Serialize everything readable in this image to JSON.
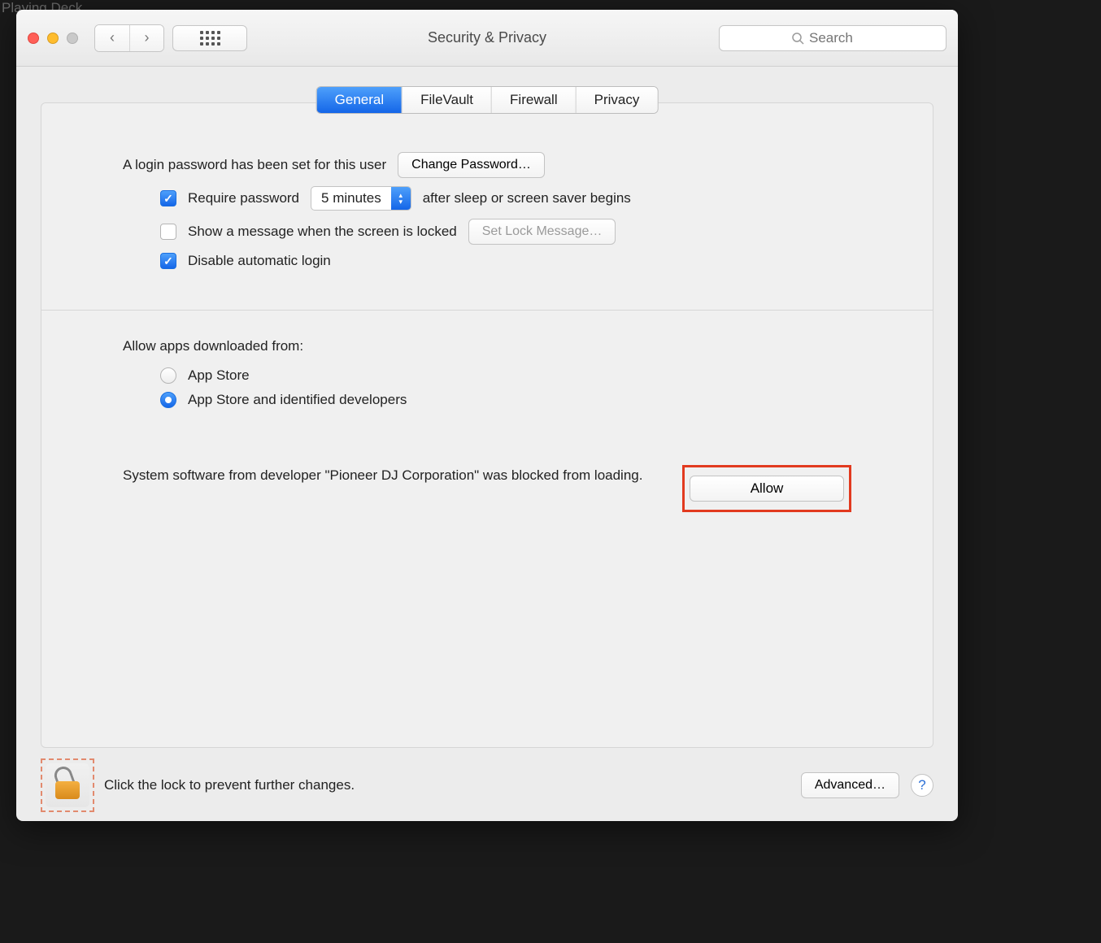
{
  "bg_text": "Playing Deck",
  "window": {
    "title": "Security & Privacy",
    "search_placeholder": "Search"
  },
  "tabs": [
    "General",
    "FileVault",
    "Firewall",
    "Privacy"
  ],
  "active_tab": "General",
  "general": {
    "login_pw_text": "A login password has been set for this user",
    "change_pw_btn": "Change Password…",
    "require_pw_label": "Require password",
    "require_pw_checked": true,
    "delay_value": "5 minutes",
    "after_text": "after sleep or screen saver begins",
    "show_msg_label": "Show a message when the screen is locked",
    "show_msg_checked": false,
    "set_lock_btn": "Set Lock Message…",
    "disable_auto_label": "Disable automatic login",
    "disable_auto_checked": true,
    "allow_apps_label": "Allow apps downloaded from:",
    "radio_appstore": "App Store",
    "radio_identified": "App Store and identified developers",
    "radio_selected": "identified",
    "blocked_text": "System software from developer \"Pioneer DJ Corporation\" was blocked from loading.",
    "allow_btn": "Allow"
  },
  "footer": {
    "lock_text": "Click the lock to prevent further changes.",
    "advanced_btn": "Advanced…"
  }
}
